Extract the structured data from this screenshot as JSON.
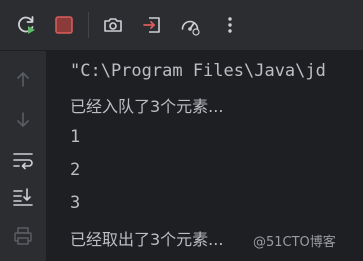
{
  "toolbar": {
    "buttons": [
      {
        "name": "rerun-icon"
      },
      {
        "name": "stop-icon"
      },
      {
        "name": "camera-icon"
      },
      {
        "name": "exit-icon"
      },
      {
        "name": "profiler-icon"
      },
      {
        "name": "more-icon"
      }
    ],
    "colors": {
      "accent_green": "#5fb865",
      "stop_red": "#db5c5c",
      "icon_gray": "#ced0d6"
    }
  },
  "sidebar": {
    "buttons": [
      {
        "name": "arrow-up-icon"
      },
      {
        "name": "arrow-down-icon"
      },
      {
        "name": "soft-wrap-icon"
      },
      {
        "name": "scroll-to-end-icon"
      },
      {
        "name": "print-icon"
      }
    ]
  },
  "console": {
    "lines": [
      "\"C:\\Program Files\\Java\\jd",
      "已经入队了3个元素...",
      "1",
      "2",
      "3",
      "已经取出了3个元素..."
    ]
  },
  "watermark": "@51CTO博客"
}
